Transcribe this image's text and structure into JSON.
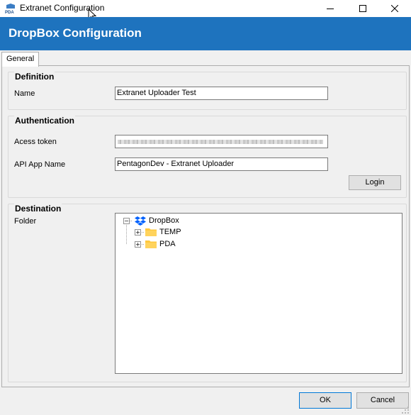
{
  "window": {
    "title": "Extranet Configuration"
  },
  "banner": {
    "title": "DropBox Configuration"
  },
  "tabs": [
    {
      "label": "General",
      "selected": true
    }
  ],
  "definition": {
    "title": "Definition",
    "name_label": "Name",
    "name_value": "Extranet Uploader Test"
  },
  "authentication": {
    "title": "Authentication",
    "access_token_label": "Acess token",
    "api_app_name_label": "API App Name",
    "api_app_name_value": "PentagonDev - Extranet Uploader",
    "login_label": "Login"
  },
  "destination": {
    "title": "Destination",
    "folder_label": "Folder",
    "tree": {
      "root": {
        "label": "DropBox",
        "expanded": true
      },
      "children": [
        {
          "label": "TEMP",
          "expanded": false
        },
        {
          "label": "PDA",
          "expanded": false
        }
      ]
    }
  },
  "footer": {
    "ok_label": "OK",
    "cancel_label": "Cancel"
  },
  "colors": {
    "banner": "#1e73be",
    "folder": "#ffc83d",
    "dropbox": "#0061fe"
  }
}
